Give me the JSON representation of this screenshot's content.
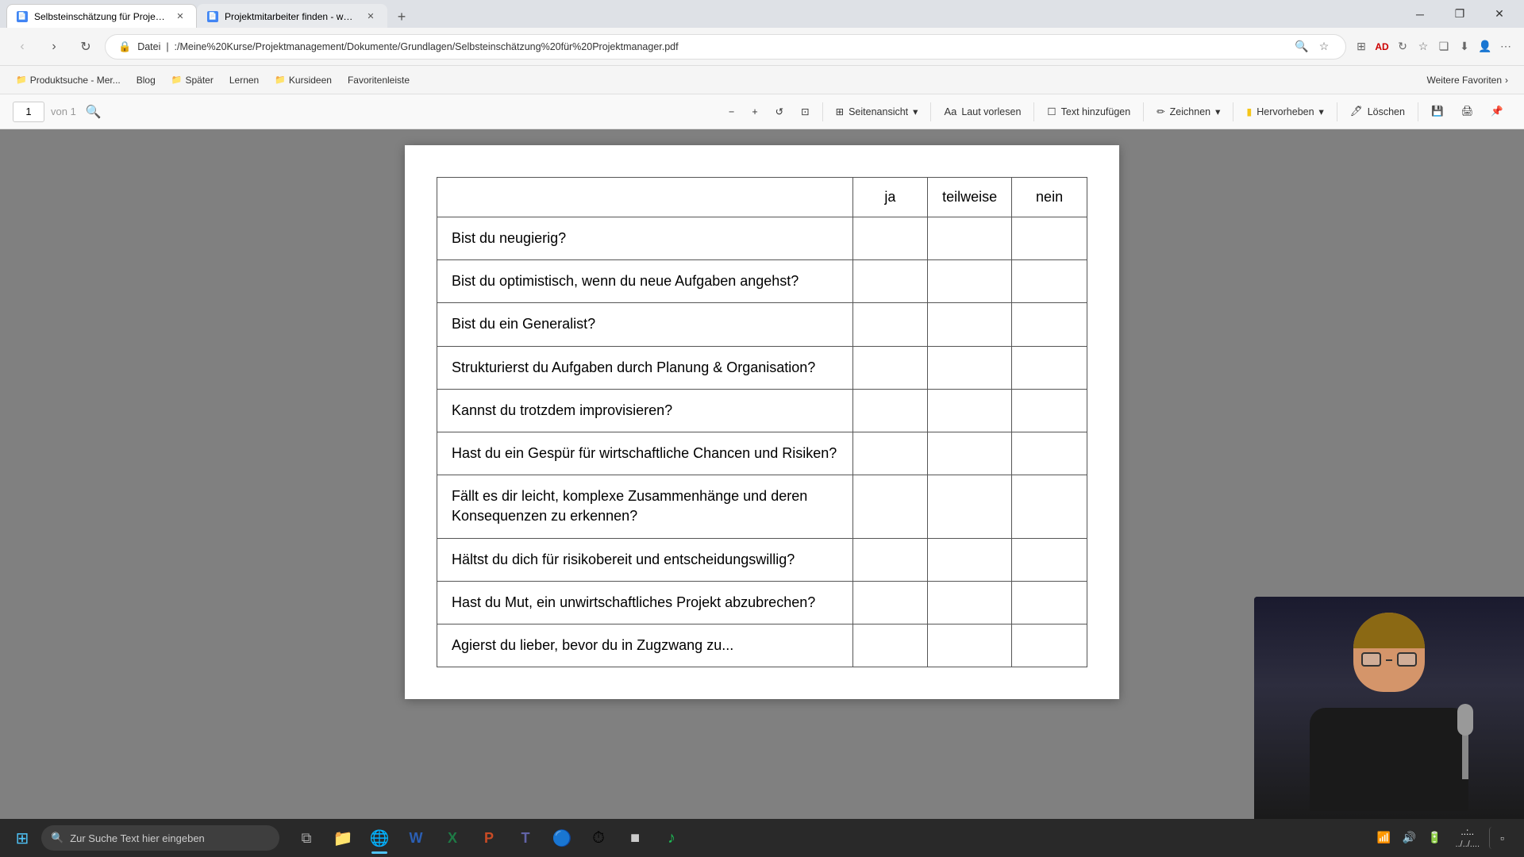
{
  "browser": {
    "tabs": [
      {
        "id": "tab1",
        "title": "Selbsteinschätzung für Projektm...",
        "active": true,
        "favicon": "📄"
      },
      {
        "id": "tab2",
        "title": "Projektmitarbeiter finden - was ...",
        "active": false,
        "favicon": "📄"
      }
    ],
    "address": "Datei   |:/Meine%20Kurse/Projektmanagement/Dokumente/Grundlagen/Selbsteinschätzung%20für%20Projektmanager.pdf",
    "address_display": "Datei  |  :/Meine%20Kurse/Projektmanagement/Dokumente/Grundlagen/Selbsteinschätzung%20für%20Projektmanager.pdf"
  },
  "bookmarks": [
    {
      "label": "Produktsuche - Mer..."
    },
    {
      "label": "Blog"
    },
    {
      "label": "Später"
    },
    {
      "label": "Lernen"
    },
    {
      "label": "Kursideen"
    },
    {
      "label": "Favoritenleiste"
    },
    {
      "label": "Weitere Favoriten"
    }
  ],
  "pdf_toolbar": {
    "page_current": "1",
    "page_total": "von 1",
    "zoom_minus": "−",
    "zoom_plus": "+",
    "rotate": "↺",
    "fit": "⊡",
    "page_view_label": "Seitenansicht",
    "read_aloud_label": "Laut vorlesen",
    "add_text_label": "Text hinzufügen",
    "draw_label": "Zeichnen",
    "highlight_label": "Hervorheben",
    "delete_label": "Löschen"
  },
  "table": {
    "headers": [
      "",
      "ja",
      "teilweise",
      "nein"
    ],
    "rows": [
      {
        "question": "Bist du neugierig?"
      },
      {
        "question": "Bist du optimistisch, wenn du neue Aufgaben angehst?"
      },
      {
        "question": "Bist du ein Generalist?"
      },
      {
        "question": "Strukturierst du Aufgaben durch Planung & Organisation?"
      },
      {
        "question": "Kannst du trotzdem improvisieren?"
      },
      {
        "question": "Hast du ein Gespür für wirtschaftliche Chancen und Risiken?"
      },
      {
        "question": "Fällt es dir leicht, komplexe Zusammenhänge und deren Konsequenzen zu erkennen?"
      },
      {
        "question": "Hältst du dich für risikobereit und entscheidungswillig?"
      },
      {
        "question": "Hast du Mut, ein unwirtschaftliches Projekt abzubrechen?"
      },
      {
        "question": "Agierst du lieber, bevor du in Zugzwang zu..."
      }
    ]
  },
  "taskbar": {
    "search_placeholder": "Zur Suche Text hier eingeben",
    "time": "...",
    "apps": [
      {
        "name": "windows",
        "icon": "⊞"
      },
      {
        "name": "search",
        "icon": "🔍"
      },
      {
        "name": "task-view",
        "icon": "❑"
      },
      {
        "name": "file-explorer",
        "icon": "📁"
      },
      {
        "name": "edge",
        "icon": "🌐"
      },
      {
        "name": "word",
        "icon": "W"
      },
      {
        "name": "excel",
        "icon": "X"
      },
      {
        "name": "powerpoint",
        "icon": "P"
      },
      {
        "name": "teams",
        "icon": "T"
      },
      {
        "name": "chrome",
        "icon": "●"
      },
      {
        "name": "clock",
        "icon": "⏱"
      },
      {
        "name": "spotify",
        "icon": "♪"
      },
      {
        "name": "unknown1",
        "icon": "■"
      },
      {
        "name": "unknown2",
        "icon": "▣"
      }
    ]
  }
}
